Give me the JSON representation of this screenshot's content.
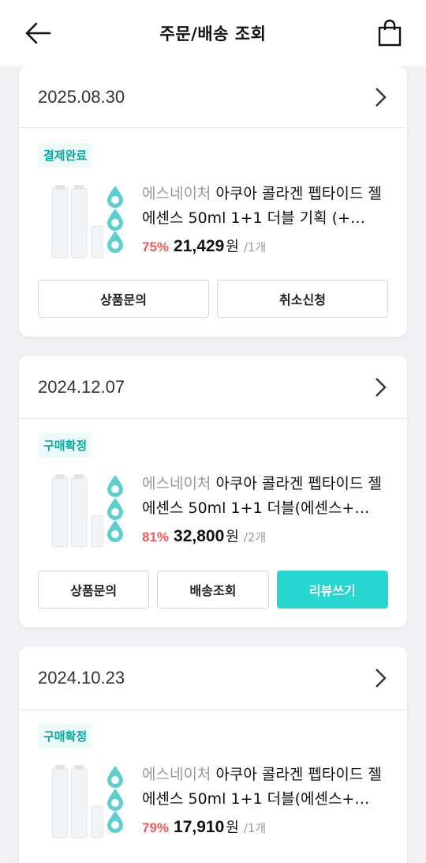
{
  "header": {
    "title": "주문/배송 조회",
    "back_icon": "arrow-left-icon",
    "cart_icon": "shopping-bag-icon"
  },
  "orders": [
    {
      "date": "2025.08.30",
      "status": "결제완료",
      "brand": "에스네이처",
      "name": "아쿠아 콜라겐 펩타이드 젤에센스 50ml 1+1 더블 기획 (+…",
      "discount": "75%",
      "price": "21,429",
      "currency": "원",
      "qty": "/1개",
      "buttons": [
        "상품문의",
        "취소신청"
      ]
    },
    {
      "date": "2024.12.07",
      "status": "구매확정",
      "brand": "에스네이처",
      "name": "아쿠아 콜라겐 펩타이드 젤에센스 50ml 1+1 더블(에센스+…",
      "discount": "81%",
      "price": "32,800",
      "currency": "원",
      "qty": "/2개",
      "buttons": [
        "상품문의",
        "배송조회",
        "리뷰쓰기"
      ]
    },
    {
      "date": "2024.10.23",
      "status": "구매확정",
      "brand": "에스네이처",
      "name": "아쿠아 콜라겐 펩타이드 젤에센스 50ml 1+1 더블(에센스+…",
      "discount": "79%",
      "price": "17,910",
      "currency": "원",
      "qty": "/1개",
      "buttons": []
    }
  ],
  "colors": {
    "accent": "#25d7d0",
    "badge_text": "#0aa7a0",
    "discount": "#ee5a5a"
  }
}
